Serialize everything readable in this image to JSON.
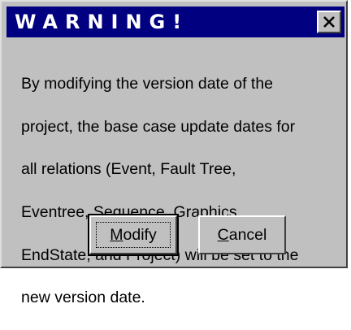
{
  "dialog": {
    "title": "WARNING!",
    "message_lines": [
      "By modifying the version date of the",
      "project, the base case update dates for",
      "all relations (Event, Fault Tree,",
      "Eventree, Sequence, Graphics,",
      "EndState, and Project) will be set to the",
      "new version date."
    ],
    "close_icon": "close-icon"
  },
  "buttons": {
    "modify": {
      "mnemonic": "M",
      "rest": "odify"
    },
    "cancel": {
      "mnemonic": "C",
      "rest": "ancel"
    }
  },
  "colors": {
    "titlebar": "#000080",
    "face": "#c0c0c0",
    "title_text": "#ffffff"
  }
}
